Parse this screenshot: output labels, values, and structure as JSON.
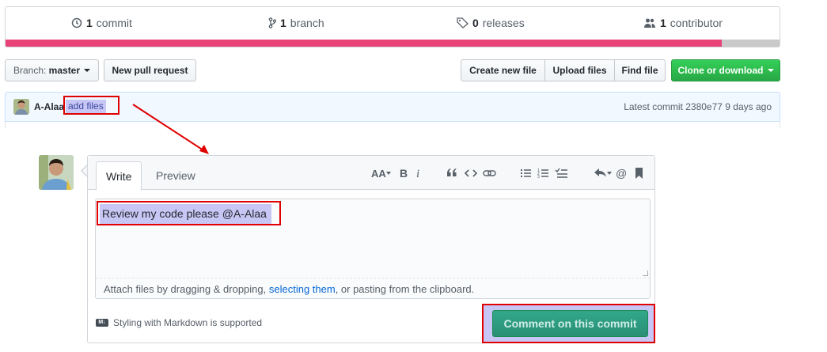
{
  "summary": {
    "commits": {
      "count": "1",
      "label": "commit",
      "icon": "history-icon"
    },
    "branches": {
      "count": "1",
      "label": "branch",
      "icon": "branch-icon"
    },
    "releases": {
      "count": "0",
      "label": "releases",
      "icon": "tag-icon"
    },
    "contributors": {
      "count": "1",
      "label": "contributor",
      "icon": "people-icon"
    },
    "language_bar": {
      "primary_fraction": 0.925,
      "primary_color": "#e8447a",
      "other_color": "#c9c9c9"
    }
  },
  "toolbar": {
    "branch_prefix": "Branch:",
    "branch_name": "master",
    "new_pr": "New pull request",
    "create_file": "Create new file",
    "upload_files": "Upload files",
    "find_file": "Find file",
    "clone": "Clone or download"
  },
  "commit": {
    "author": "A-Alaa",
    "message": "add files",
    "latest_label": "Latest commit 2380e77 9 days ago"
  },
  "composer": {
    "tabs": [
      "Write",
      "Preview"
    ],
    "text": "Review my code please @A-Alaa",
    "attach_prefix": "Attach files by dragging & dropping, ",
    "attach_link": "selecting them",
    "attach_suffix": ", or pasting from the clipboard.",
    "markdown_note": "Styling with Markdown is supported",
    "submit": "Comment on this commit",
    "toolbar_icons": [
      "text-size-icon",
      "bold-icon",
      "italic-icon",
      "quote-icon",
      "code-icon",
      "link-icon",
      "unordered-list-icon",
      "ordered-list-icon",
      "task-list-icon",
      "reply-icon",
      "mention-icon",
      "bookmark-icon"
    ]
  },
  "colors": {
    "annotation_red": "#e00000",
    "highlight": "#c7c6f5",
    "clone_green": "#28a745",
    "link": "#0366d6"
  }
}
